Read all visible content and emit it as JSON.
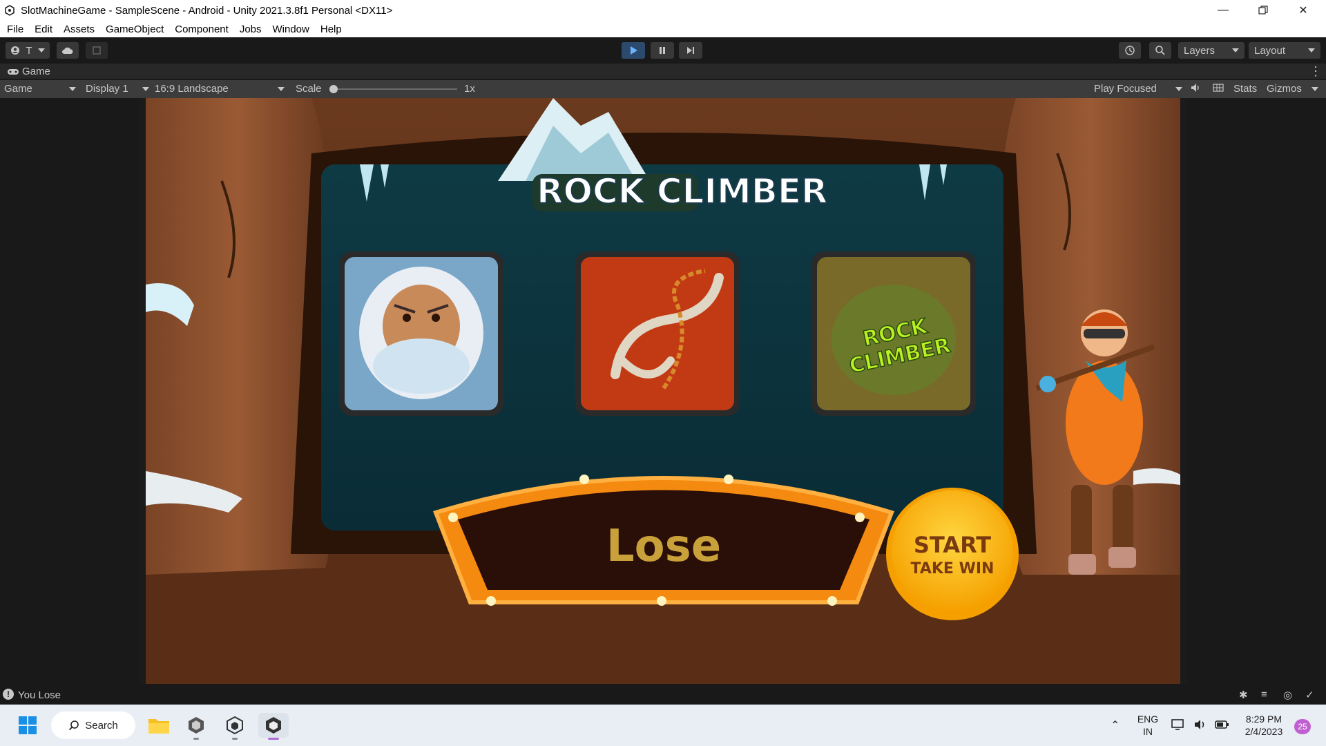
{
  "window": {
    "title": "SlotMachineGame - SampleScene - Android - Unity 2021.3.8f1 Personal <DX11>",
    "controls": [
      "minimize",
      "restore",
      "close"
    ]
  },
  "menu": [
    "File",
    "Edit",
    "Assets",
    "GameObject",
    "Component",
    "Jobs",
    "Window",
    "Help"
  ],
  "toolbar": {
    "account_label": "T",
    "layers_label": "Layers",
    "layout_label": "Layout",
    "play_icon": "play-icon",
    "pause_icon": "pause-icon",
    "step_icon": "step-icon"
  },
  "game_tab": {
    "label": "Game",
    "view_select": "Game",
    "display_select": "Display 1",
    "aspect_select": "16:9 Landscape",
    "scale_label": "Scale",
    "scale_value": "1x",
    "play_mode": "Play Focused",
    "stats_label": "Stats",
    "gizmos_label": "Gizmos"
  },
  "game": {
    "title_line": "ROCK CLIMBER",
    "reels": [
      "yeti",
      "grappling-hook",
      "rock-climber-logo"
    ],
    "result_text": "Lose",
    "start_label": "START",
    "take_win_label": "TAKE WIN",
    "logo_text_1": "ROCK",
    "logo_text_2": "CLIMBER"
  },
  "status": {
    "message": "You Lose"
  },
  "taskbar": {
    "search_label": "Search",
    "lang_top": "ENG",
    "lang_bottom": "IN",
    "time": "8:29 PM",
    "date": "2/4/2023",
    "notification_count": "25"
  }
}
